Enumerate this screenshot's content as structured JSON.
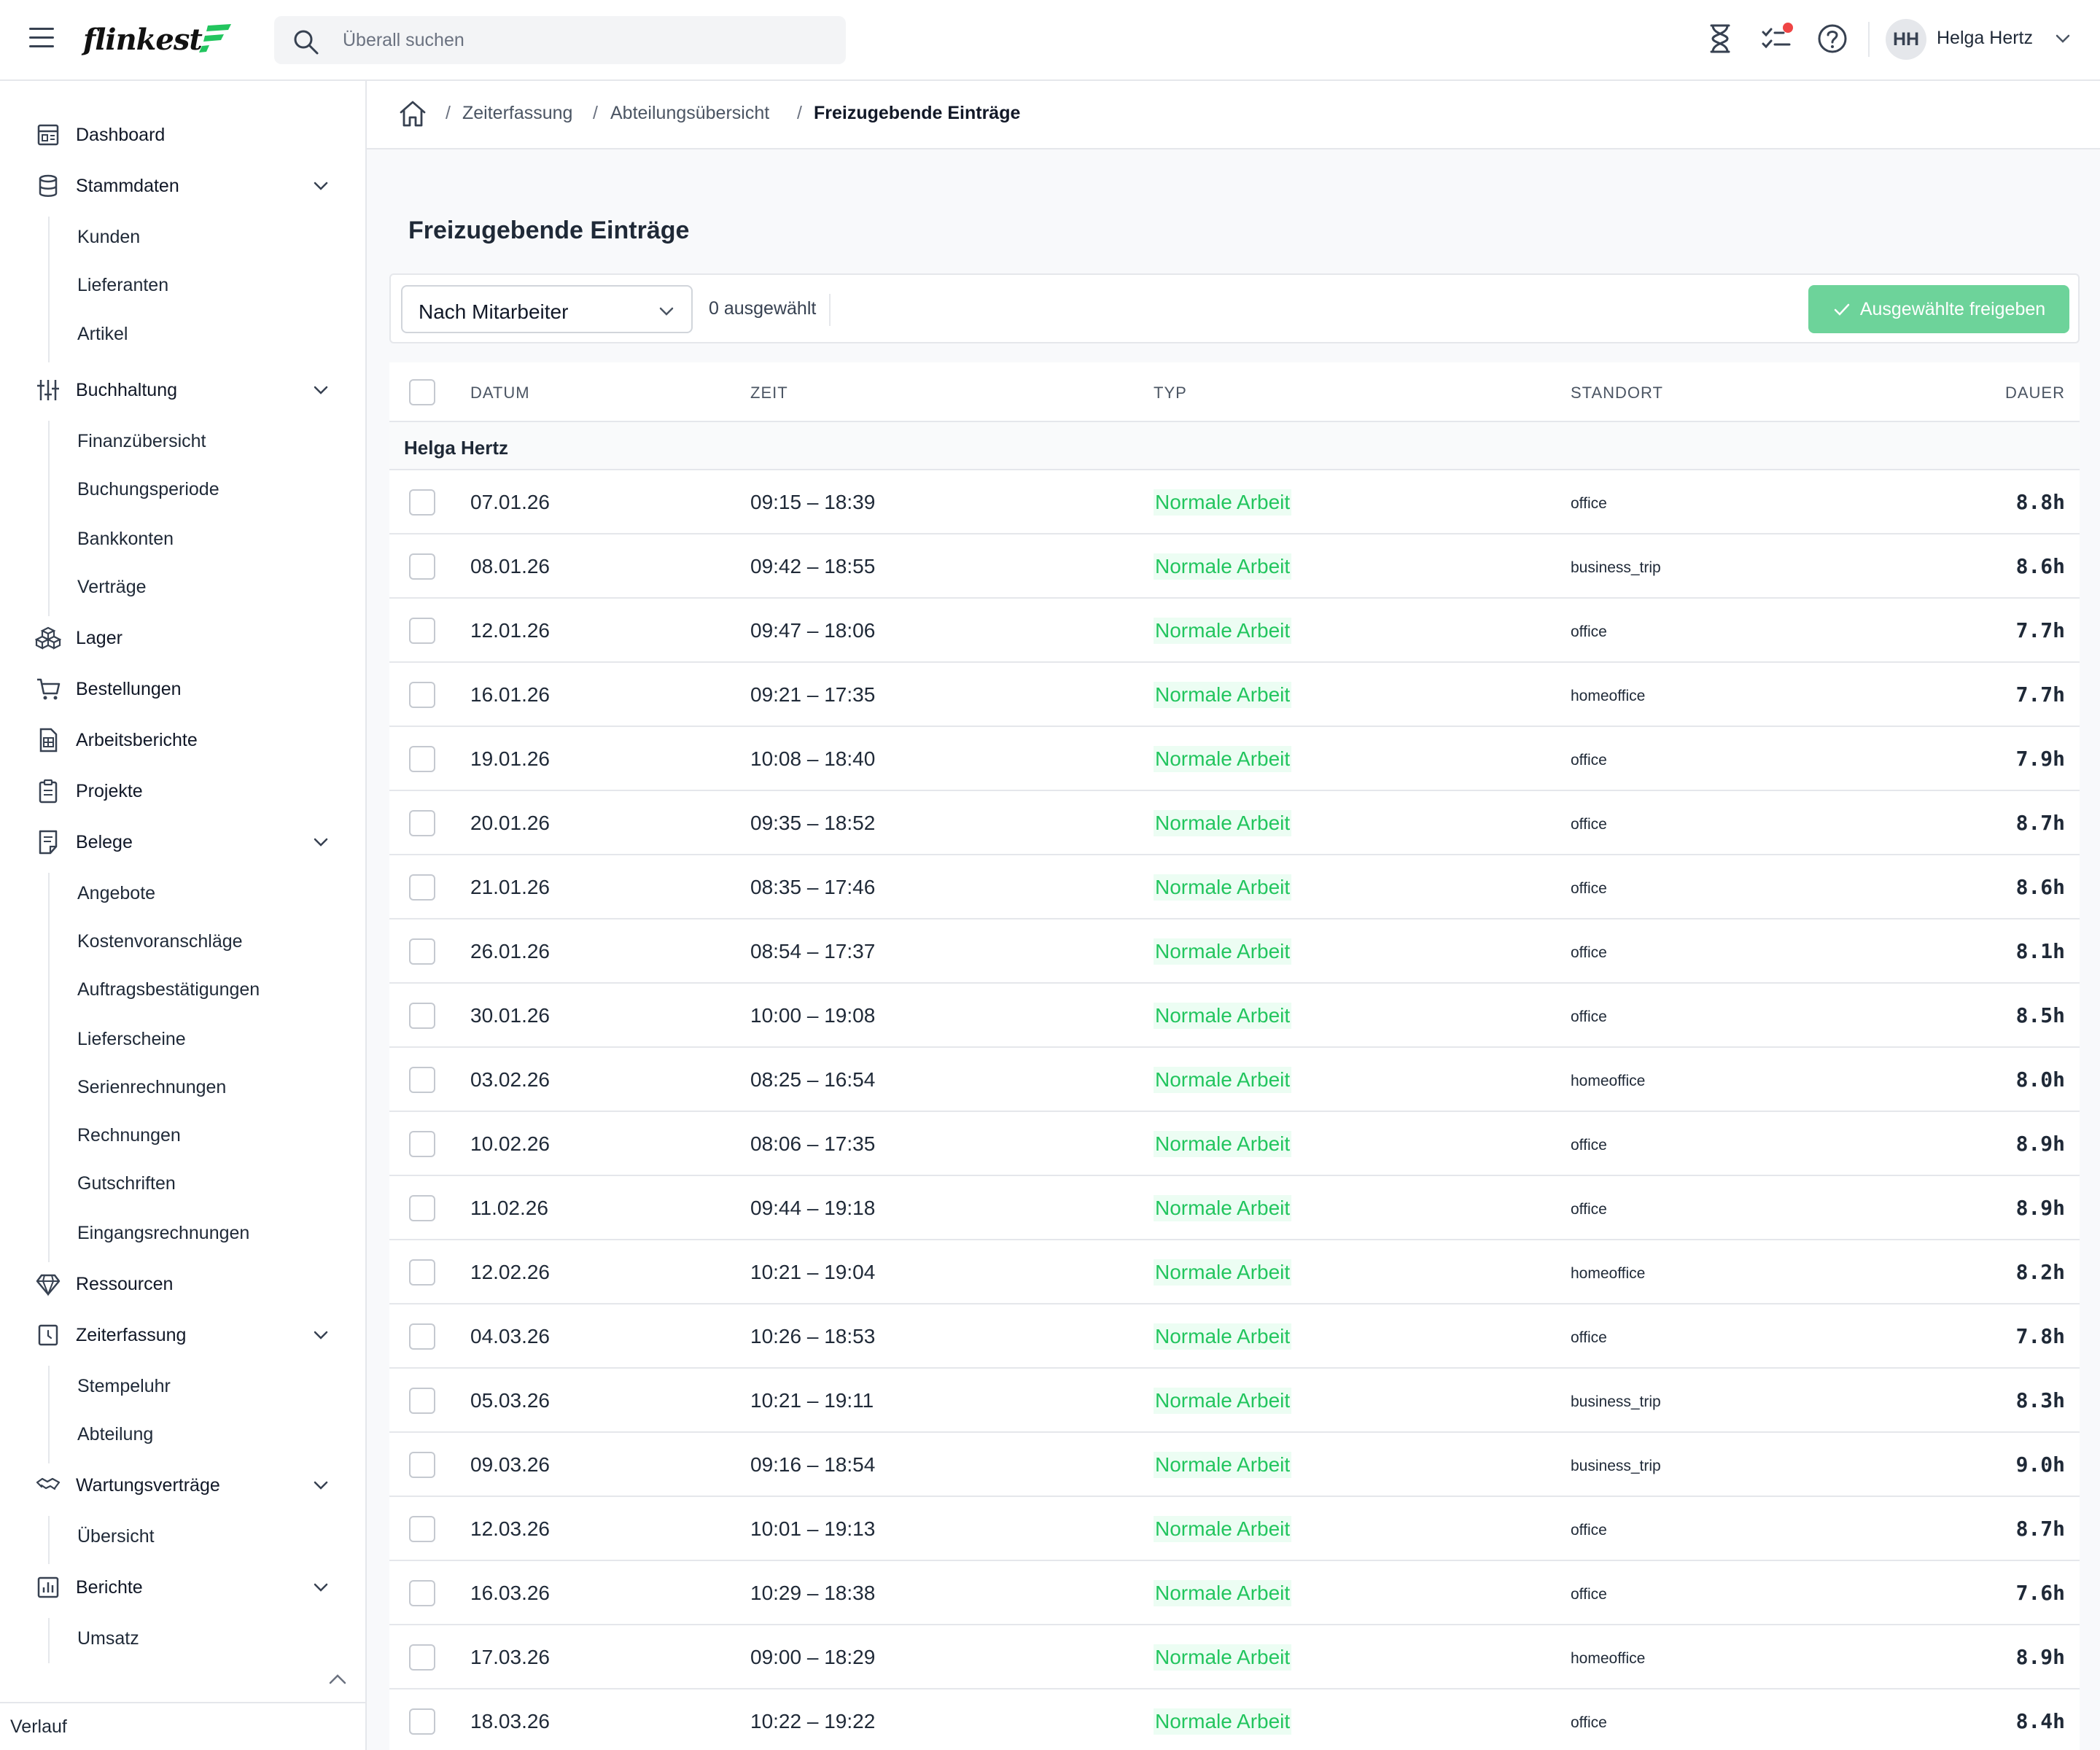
{
  "app": {
    "logo": "flinkest"
  },
  "header": {
    "search_placeholder": "Überall suchen",
    "user_initials": "HH",
    "user_name": "Helga Hertz"
  },
  "sidebar": {
    "dashboard": "Dashboard",
    "stammdaten": "Stammdaten",
    "kunden": "Kunden",
    "lieferanten": "Lieferanten",
    "artikel": "Artikel",
    "buchhaltung": "Buchhaltung",
    "finanzuebersicht": "Finanzübersicht",
    "buchungsperiode": "Buchungsperiode",
    "bankkonten": "Bankkonten",
    "vertraege": "Verträge",
    "lager": "Lager",
    "bestellungen": "Bestellungen",
    "arbeitsberichte": "Arbeitsberichte",
    "projekte": "Projekte",
    "belege": "Belege",
    "angebote": "Angebote",
    "kostenvoranschlaege": "Kostenvoranschläge",
    "auftragsbestaetigungen": "Auftragsbestätigungen",
    "lieferscheine": "Lieferscheine",
    "serienrechnungen": "Serienrechnungen",
    "rechnungen": "Rechnungen",
    "gutschriften": "Gutschriften",
    "eingangsrechnungen": "Eingangsrechnungen",
    "ressourcen": "Ressourcen",
    "zeiterfassung": "Zeiterfassung",
    "stempeluhr": "Stempeluhr",
    "abteilung": "Abteilung",
    "wartungsvertraege": "Wartungsverträge",
    "uebersicht": "Übersicht",
    "berichte": "Berichte",
    "umsatz": "Umsatz",
    "verlauf": "Verlauf"
  },
  "breadcrumb": {
    "items": [
      "Zeiterfassung",
      "Abteilungsübersicht",
      "Freizugebende Einträge"
    ]
  },
  "page": {
    "title": "Freizugebende Einträge",
    "group_select": "Nach Mitarbeiter",
    "selected_count": "0 ausgewählt",
    "approve_button": "Ausgewählte freigeben"
  },
  "table": {
    "columns": {
      "date": "DATUM",
      "time": "ZEIT",
      "type": "TYP",
      "location": "STANDORT",
      "duration": "DAUER"
    },
    "group": "Helga Hertz",
    "rows": [
      {
        "date": "07.01.26",
        "time": "09:15 – 18:39",
        "type": "Normale Arbeit",
        "location": "office",
        "duration": "8.8h"
      },
      {
        "date": "08.01.26",
        "time": "09:42 – 18:55",
        "type": "Normale Arbeit",
        "location": "business_trip",
        "duration": "8.6h"
      },
      {
        "date": "12.01.26",
        "time": "09:47 – 18:06",
        "type": "Normale Arbeit",
        "location": "office",
        "duration": "7.7h"
      },
      {
        "date": "16.01.26",
        "time": "09:21 – 17:35",
        "type": "Normale Arbeit",
        "location": "homeoffice",
        "duration": "7.7h"
      },
      {
        "date": "19.01.26",
        "time": "10:08 – 18:40",
        "type": "Normale Arbeit",
        "location": "office",
        "duration": "7.9h"
      },
      {
        "date": "20.01.26",
        "time": "09:35 – 18:52",
        "type": "Normale Arbeit",
        "location": "office",
        "duration": "8.7h"
      },
      {
        "date": "21.01.26",
        "time": "08:35 – 17:46",
        "type": "Normale Arbeit",
        "location": "office",
        "duration": "8.6h"
      },
      {
        "date": "26.01.26",
        "time": "08:54 – 17:37",
        "type": "Normale Arbeit",
        "location": "office",
        "duration": "8.1h"
      },
      {
        "date": "30.01.26",
        "time": "10:00 – 19:08",
        "type": "Normale Arbeit",
        "location": "office",
        "duration": "8.5h"
      },
      {
        "date": "03.02.26",
        "time": "08:25 – 16:54",
        "type": "Normale Arbeit",
        "location": "homeoffice",
        "duration": "8.0h"
      },
      {
        "date": "10.02.26",
        "time": "08:06 – 17:35",
        "type": "Normale Arbeit",
        "location": "office",
        "duration": "8.9h"
      },
      {
        "date": "11.02.26",
        "time": "09:44 – 19:18",
        "type": "Normale Arbeit",
        "location": "office",
        "duration": "8.9h"
      },
      {
        "date": "12.02.26",
        "time": "10:21 – 19:04",
        "type": "Normale Arbeit",
        "location": "homeoffice",
        "duration": "8.2h"
      },
      {
        "date": "04.03.26",
        "time": "10:26 – 18:53",
        "type": "Normale Arbeit",
        "location": "office",
        "duration": "7.8h"
      },
      {
        "date": "05.03.26",
        "time": "10:21 – 19:11",
        "type": "Normale Arbeit",
        "location": "business_trip",
        "duration": "8.3h"
      },
      {
        "date": "09.03.26",
        "time": "09:16 – 18:54",
        "type": "Normale Arbeit",
        "location": "business_trip",
        "duration": "9.0h"
      },
      {
        "date": "12.03.26",
        "time": "10:01 – 19:13",
        "type": "Normale Arbeit",
        "location": "office",
        "duration": "8.7h"
      },
      {
        "date": "16.03.26",
        "time": "10:29 – 18:38",
        "type": "Normale Arbeit",
        "location": "office",
        "duration": "7.6h"
      },
      {
        "date": "17.03.26",
        "time": "09:00 – 18:29",
        "type": "Normale Arbeit",
        "location": "homeoffice",
        "duration": "8.9h"
      },
      {
        "date": "18.03.26",
        "time": "10:22 – 19:22",
        "type": "Normale Arbeit",
        "location": "office",
        "duration": "8.4h"
      }
    ]
  },
  "colors": {
    "accent": "#22c55e",
    "button": "#6dd39a",
    "notification": "#ef4444"
  },
  "icons": [
    "menu-icon",
    "search-icon",
    "hourglass-icon",
    "tasks-icon",
    "help-icon",
    "chevron-down-icon",
    "home-icon",
    "check-icon",
    "chevron-up-icon"
  ]
}
